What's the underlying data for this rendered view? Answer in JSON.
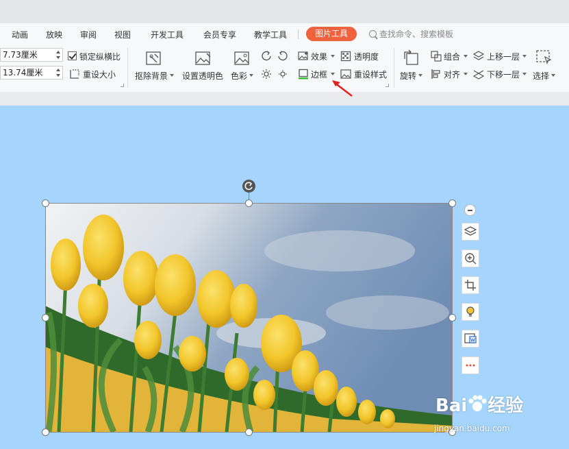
{
  "menubar": {
    "items": [
      "动画",
      "放映",
      "审阅",
      "视图",
      "开发工具",
      "会员专享",
      "教学工具"
    ],
    "active_tab": "图片工具",
    "search_placeholder": "查找命令、搜索模板"
  },
  "ribbon": {
    "width_value": "7.73厘米",
    "height_value": "13.74厘米",
    "lock_ratio_label": "锁定纵横比",
    "lock_ratio_checked": true,
    "reset_size_label": "重设大小",
    "remove_bg_label": "抠除背景",
    "set_transparent_label": "设置透明色",
    "color_label": "色彩",
    "effects_label": "效果",
    "transparency_label": "透明度",
    "border_label": "边框",
    "reset_style_label": "重设样式",
    "rotate_label": "旋转",
    "group_label": "组合",
    "align_label": "对齐",
    "bring_forward_label": "上移一层",
    "send_backward_label": "下移一层",
    "select_label": "选择"
  },
  "watermark": {
    "brand": "Bai",
    "brand2": "经验",
    "url": "jingyan.baidu.com"
  },
  "colors": {
    "canvas_bg": "#a5d5fd",
    "active_tab": "#f0623e",
    "annotation_arrow": "#e01f1f"
  }
}
